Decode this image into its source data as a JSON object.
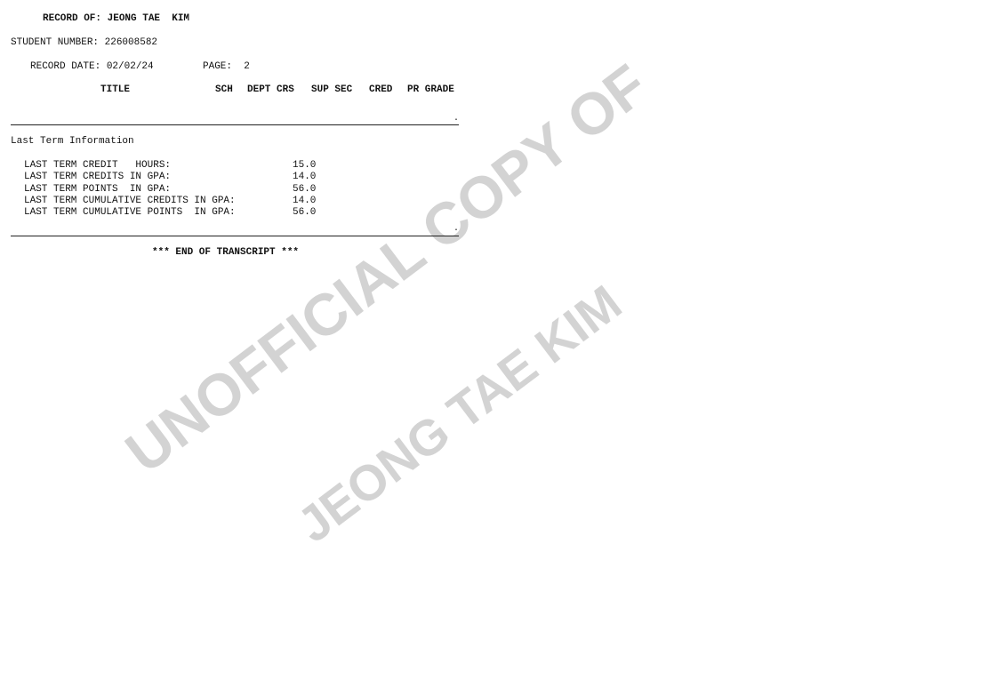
{
  "header": {
    "record_of": "RECORD OF: JEONG TAE  KIM",
    "student_number": "STUDENT NUMBER: 226008582",
    "record_date": "RECORD DATE: 02/02/24",
    "page": "PAGE:  2"
  },
  "columns": {
    "title": "TITLE",
    "sch": "SCH",
    "dept_crs": "DEPT CRS",
    "sup_sec": "SUP SEC",
    "cred": "CRED",
    "pr_grade": "PR GRADE"
  },
  "section_title": "Last Term Information",
  "last_term": [
    {
      "label": "LAST TERM CREDIT   HOURS:",
      "value": "15.0"
    },
    {
      "label": "LAST TERM CREDITS IN GPA:",
      "value": "14.0"
    },
    {
      "label": "LAST TERM POINTS  IN GPA:",
      "value": "56.0"
    },
    {
      "label": "LAST TERM CUMULATIVE CREDITS IN GPA:",
      "value": "14.0"
    },
    {
      "label": "LAST TERM CUMULATIVE POINTS  IN GPA:",
      "value": "56.0"
    }
  ],
  "end_text": "*** END OF TRANSCRIPT ***",
  "watermark": {
    "line1": "UNOFFICIAL COPY OF",
    "line2": "JEONG TAE KIM",
    "color": "#d3d3d3"
  }
}
